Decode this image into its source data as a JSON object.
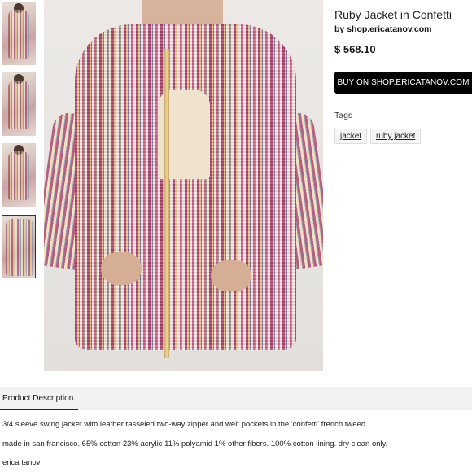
{
  "product": {
    "title": "Ruby Jacket in Confetti",
    "by_prefix": "by",
    "seller": "shop.ericatanov.com",
    "price": "$ 568.10",
    "buy_label": "BUY ON SHOP.ERICATANOV.COM"
  },
  "tags": {
    "label": "Tags",
    "items": [
      "jacket",
      "ruby jacket"
    ]
  },
  "thumbnails": {
    "count": 4,
    "selected": 4
  },
  "description": {
    "tab_label": "Product Description",
    "lines": [
      "3/4 sleeve swing jacket with leather tasseled two-way zipper and welt pockets in the 'confetti' french tweed.",
      "made in san francisco. 65% cotton 23% acrylic 11% polyamid 1% other fibers. 100% cotton lining. dry clean only.",
      "erica tanov"
    ]
  },
  "colors": {
    "button_bg": "#000000",
    "button_text": "#ffffff",
    "tab_bar_bg": "#f2f2f2"
  }
}
